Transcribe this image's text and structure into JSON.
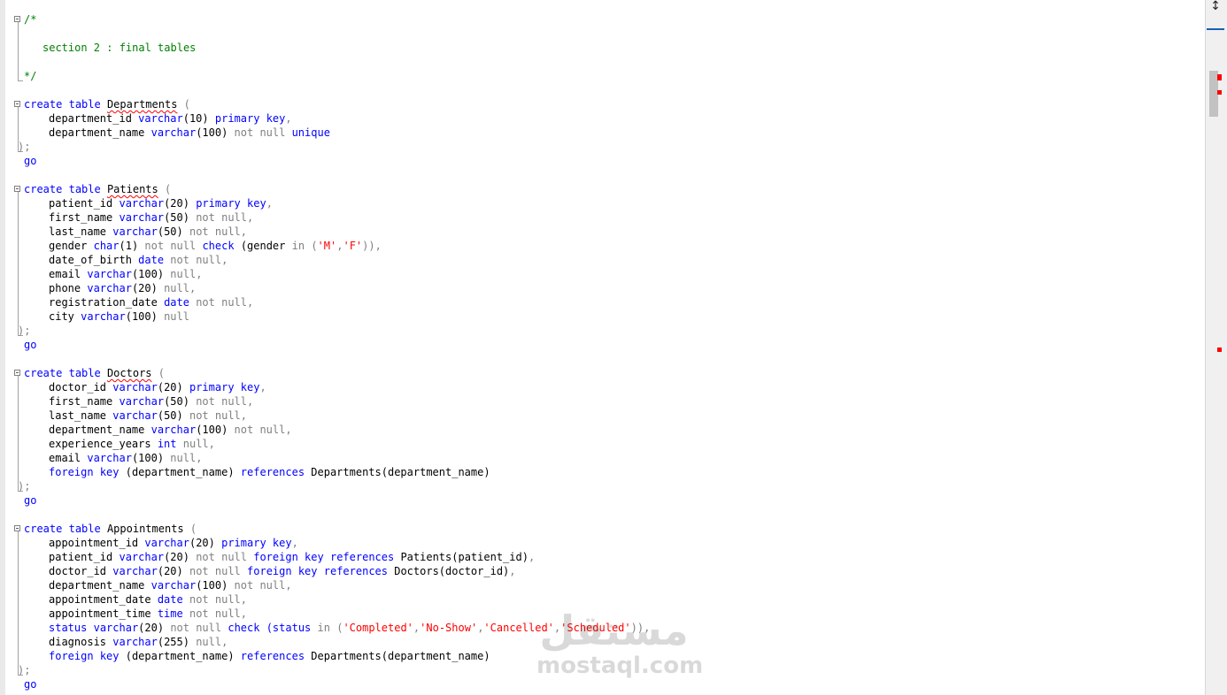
{
  "editor": {
    "colors": {
      "keyword": "#0000ff",
      "operator": "#808080",
      "string": "#ff0000",
      "comment": "#008000",
      "text": "#000000",
      "background": "#ffffff"
    },
    "comment_open": "/*",
    "comment_text": "section 2 : final tables",
    "comment_close": "*/",
    "go": "go",
    "close_paren": ");",
    "departments": {
      "header": [
        "create",
        "table",
        "Departments",
        "("
      ],
      "l1": [
        "department_id",
        "varchar",
        "(10)",
        "primary",
        "key",
        ","
      ],
      "l2": [
        "department_name",
        "varchar",
        "(100)",
        "not null",
        "unique"
      ]
    },
    "patients": {
      "header": [
        "create",
        "table",
        "Patients",
        "("
      ],
      "l1": [
        "patient_id",
        "varchar",
        "(20)",
        "primary",
        "key",
        ","
      ],
      "l2": [
        "first_name",
        "varchar",
        "(50)",
        "not null,"
      ],
      "l3": [
        "last_name",
        "varchar",
        "(50)",
        "not null,"
      ],
      "l4": [
        "gender",
        "char",
        "(1)",
        "not null",
        "check",
        "(gender",
        "in",
        "(",
        "'M'",
        ",",
        "'F'",
        ")),"
      ],
      "l5": [
        "date_of_birth",
        "date",
        "not null,"
      ],
      "l6": [
        "email",
        "varchar",
        "(100)",
        "null,"
      ],
      "l7": [
        "phone",
        "varchar",
        "(20)",
        "null,"
      ],
      "l8": [
        "registration_date",
        "date",
        "not null,"
      ],
      "l9": [
        "city",
        "varchar",
        "(100)",
        "null"
      ]
    },
    "doctors": {
      "header": [
        "create",
        "table",
        "Doctors",
        "("
      ],
      "l1": [
        "doctor_id",
        "varchar",
        "(20)",
        "primary",
        "key",
        ","
      ],
      "l2": [
        "first_name",
        "varchar",
        "(50)",
        "not null,"
      ],
      "l3": [
        "last_name",
        "varchar",
        "(50)",
        "not null,"
      ],
      "l4": [
        "department_name",
        "varchar",
        "(100)",
        "not null,"
      ],
      "l5": [
        "experience_years",
        "int",
        "null,"
      ],
      "l6": [
        "email",
        "varchar",
        "(100)",
        "null,"
      ],
      "l7": [
        "foreign",
        "key",
        "(department_name)",
        "references",
        "Departments(department_name)"
      ]
    },
    "appointments": {
      "header": [
        "create",
        "table",
        "Appointments",
        "("
      ],
      "l1": [
        "appointment_id",
        "varchar",
        "(20)",
        "primary",
        "key",
        ","
      ],
      "l2": [
        "patient_id",
        "varchar",
        "(20)",
        "not null",
        "foreign",
        "key",
        "references",
        "Patients(patient_id)",
        ","
      ],
      "l3": [
        "doctor_id",
        "varchar",
        "(20)",
        "not null",
        "foreign",
        "key",
        "references",
        "Doctors(doctor_id)",
        ","
      ],
      "l4": [
        "department_name",
        "varchar",
        "(100)",
        "not null,"
      ],
      "l5": [
        "appointment_date",
        "date",
        "not null,"
      ],
      "l6": [
        "appointment_time",
        "time",
        "not null,"
      ],
      "l7": [
        "status",
        "varchar",
        "(20)",
        "not null",
        "check",
        "(status",
        "in",
        "(",
        "'Completed'",
        ",",
        "'No-Show'",
        ",",
        "'Cancelled'",
        ",",
        "'Scheduled'",
        ")),"
      ],
      "l8": [
        "diagnosis",
        "varchar",
        "(255)",
        "null,"
      ],
      "l9": [
        "foreign",
        "key",
        "(department_name)",
        "references",
        "Departments(department_name)"
      ]
    }
  },
  "scrollbar": {
    "split_icon": "split-pane-icon",
    "error_marker_color": "#ff0000"
  },
  "watermark": {
    "arabic": "مستقل",
    "latin": "mostaql.com"
  }
}
